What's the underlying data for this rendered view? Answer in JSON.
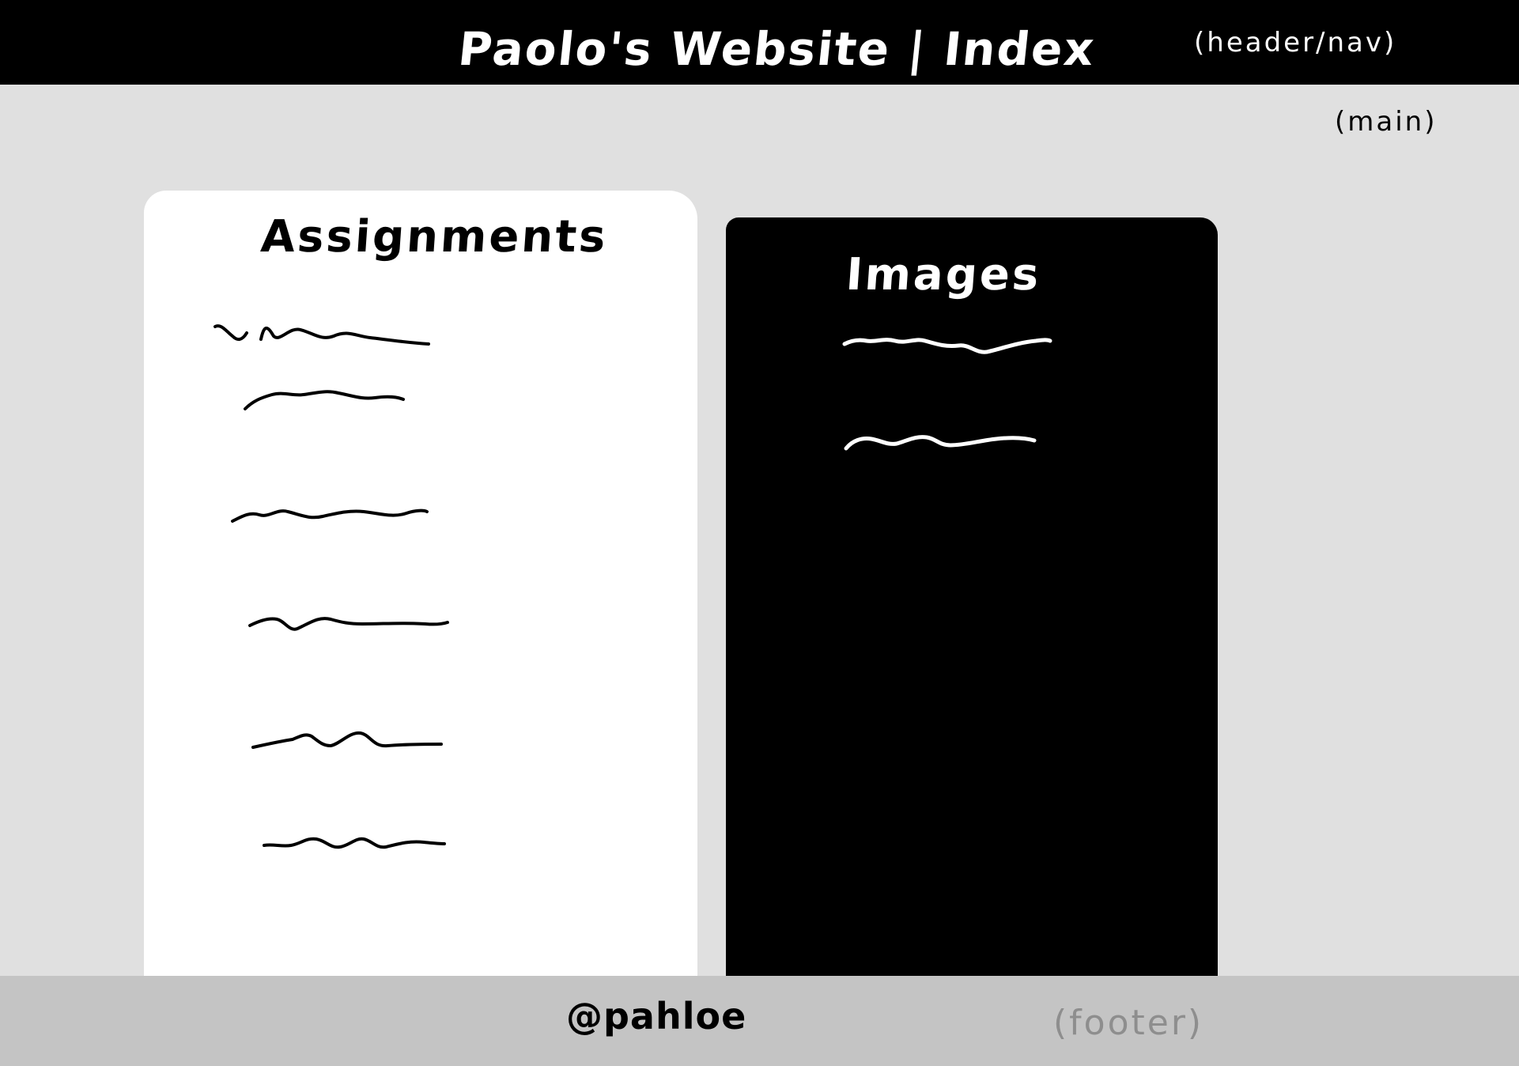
{
  "header": {
    "title": "Paolo's Website | Index",
    "annotation": "(header/nav)"
  },
  "main": {
    "annotation": "(main)",
    "assignments": {
      "title": "Assignments",
      "link_count": 6
    },
    "images": {
      "title": "Images",
      "link_count": 2
    }
  },
  "footer": {
    "handle": "@pahloe",
    "annotation": "(footer)"
  },
  "colors": {
    "header_bg": "#000000",
    "main_bg": "#e0e0e0",
    "footer_bg": "#c4c4c4",
    "assignments_card": "#ffffff",
    "images_card": "#000000"
  }
}
